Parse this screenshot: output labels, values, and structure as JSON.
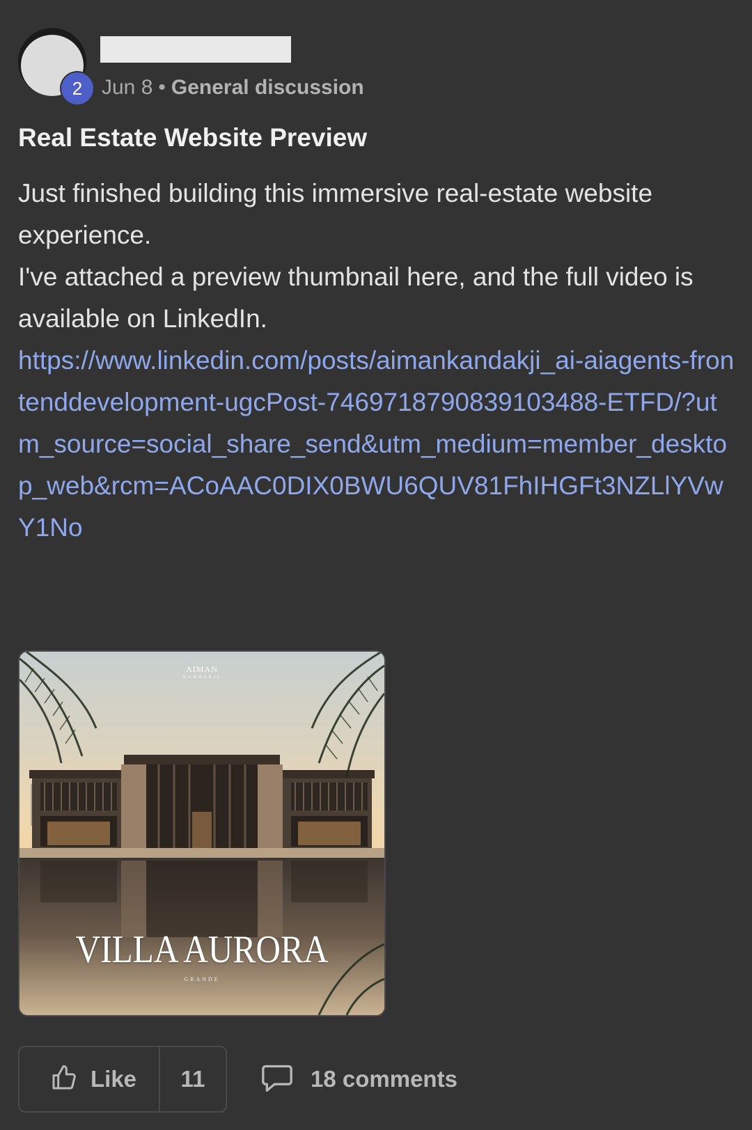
{
  "author": {
    "level": "2"
  },
  "meta": {
    "date": "Jun 8",
    "separator": "•",
    "category": "General discussion"
  },
  "post": {
    "title": "Real Estate Website Preview",
    "body_line_1": "Just finished building this immersive real-estate website experience.",
    "body_line_2": "I've attached a preview thumbnail here, and the full video is available on LinkedIn.",
    "link": "https://www.linkedin.com/posts/aimankandakji_ai-aiagents-frontenddevelopment-ugcPost-7469718790839103488-ETFD/?utm_source=social_share_send&utm_medium=member_desktop_web&rcm=ACoAAC0DIX0BWU6QUV81FhIHGFt3NZLlYVwY1No"
  },
  "thumbnail": {
    "brand": "AIMAN",
    "brand_sub": "KANDAKJI",
    "title": "VILLA AURORA",
    "subtitle": "GRANDE"
  },
  "actions": {
    "like_label": "Like",
    "like_count": "11",
    "comments_label": "18 comments"
  },
  "icons": {
    "like": "thumbs-up-icon",
    "comments": "speech-bubble-icon"
  }
}
